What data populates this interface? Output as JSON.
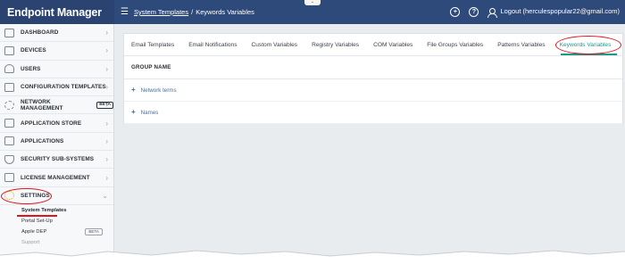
{
  "app": {
    "title": "Endpoint Manager"
  },
  "header": {
    "breadcrumb_link": "System Templates",
    "breadcrumb_sep": "/",
    "breadcrumb_current": "Keywords Variables",
    "logout_label": "Logout (herculespopular22@gmail.com)",
    "help_glyph": "?",
    "add_glyph": "+"
  },
  "sidebar": {
    "items": [
      {
        "label": "DASHBOARD",
        "icon": "dashboard-icon"
      },
      {
        "label": "DEVICES",
        "icon": "devices-icon"
      },
      {
        "label": "USERS",
        "icon": "users-icon"
      },
      {
        "label": "CONFIGURATION TEMPLATES",
        "icon": "config-templates-icon"
      },
      {
        "label": "NETWORK MANAGEMENT",
        "icon": "network-icon",
        "badge": "BETA"
      },
      {
        "label": "APPLICATION STORE",
        "icon": "app-store-icon"
      },
      {
        "label": "APPLICATIONS",
        "icon": "applications-icon"
      },
      {
        "label": "SECURITY SUB-SYSTEMS",
        "icon": "shield-icon"
      },
      {
        "label": "LICENSE MANAGEMENT",
        "icon": "license-icon"
      },
      {
        "label": "SETTINGS",
        "icon": "gear-icon"
      }
    ],
    "settings_sub": [
      {
        "label": "System Templates"
      },
      {
        "label": "Portal Set-Up"
      },
      {
        "label": "Apple DEP",
        "badge": "BETA"
      },
      {
        "label": "Support"
      }
    ]
  },
  "tabs": [
    "Email Templates",
    "Email Notifications",
    "Custom Variables",
    "Registry Variables",
    "COM Variables",
    "File Groups Variables",
    "Patterns Variables",
    "Keywords Variables"
  ],
  "table": {
    "header": "GROUP NAME",
    "rows": [
      {
        "expander": "+",
        "label": "Network terms"
      },
      {
        "expander": "+",
        "label": "Names"
      }
    ]
  },
  "colors": {
    "topbar": "#2e4a7a",
    "active_tab": "#1a9a8a",
    "annotation": "#e0141b",
    "settings_icon": "#e0a21a"
  }
}
